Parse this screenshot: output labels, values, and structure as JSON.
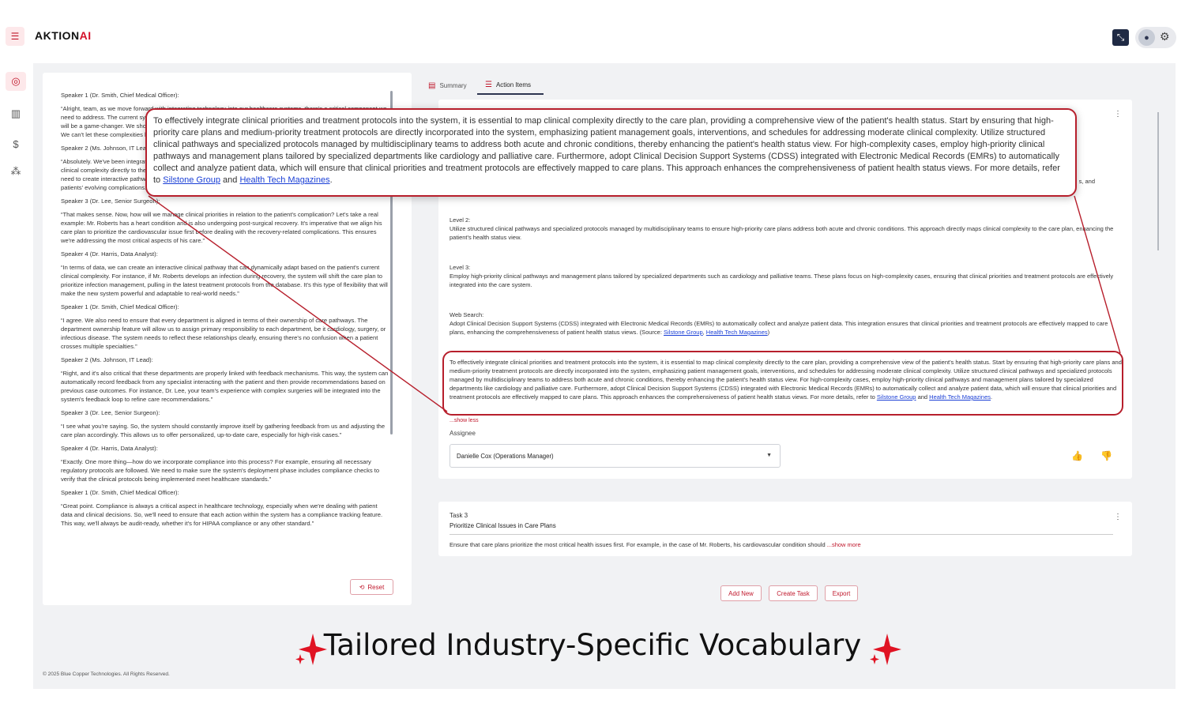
{
  "header": {
    "logo_main": "AKTION",
    "logo_accent": "AI",
    "menu_icon": "hamburger-icon",
    "collapse_icon": "collapse-icon",
    "avatar_icon": "user-icon",
    "settings_icon": "gear-icon"
  },
  "sidebar": {
    "icons": [
      "dashboard-icon",
      "bar-chart-icon",
      "dollar-icon",
      "team-icon"
    ]
  },
  "transcript": {
    "lines": [
      {
        "speaker": "Speaker 1 (Dr. Smith, Chief Medical Officer):",
        "text": "“Alright, team, as we move forward with integrating technology into our healthcare systems, there's a critical component we need to address. The current system isn't flexible enough. It's been too cumbersome. Moving toward interactive pathways will be a game-changer. We should also review the Clinical Complexity and how it connects to the patient's health status. We can't let these complexities hinder our goals.”"
      },
      {
        "speaker": "Speaker 2 (Ms. Johnson, IT Lead):",
        "text": "“Absolutely. We've been integrating the interactive clinical pathways. But we need to ensure there is a way to map the clinical complexity directly to the care plan, providing a comprehensive view of the patient's health status. I also think we need to create interactive pathways that update milestones in real-time. The dynamic flow will make it easier to adapt to patients' evolving complications.”"
      },
      {
        "speaker": "Speaker 3 (Dr. Lee, Senior Surgeon):",
        "text": "“That makes sense. Now, how will we manage clinical priorities in relation to the patient's complication? Let's take a real example: Mr. Roberts has a heart condition and is also undergoing post-surgical recovery. It's imperative that we align his care plan to prioritize the cardiovascular issue first before dealing with the recovery-related complications. This ensures we're addressing the most critical aspects of his care.”"
      },
      {
        "speaker": "Speaker 4 (Dr. Harris, Data Analyst):",
        "text": "“In terms of data, we can create an interactive clinical pathway that can dynamically adapt based on the patient's current clinical complexity. For instance, if Mr. Roberts develops an infection during recovery, the system will shift the care plan to prioritize infection management, pulling in the latest treatment protocols from the database. It's this type of flexibility that will make the new system powerful and adaptable to real-world needs.”"
      },
      {
        "speaker": "Speaker 1 (Dr. Smith, Chief Medical Officer):",
        "text": "“I agree. We also need to ensure that every department is aligned in terms of their ownership of care pathways. The department ownership feature will allow us to assign primary responsibility to each department, be it cardiology, surgery, or infectious disease. The system needs to reflect these relationships clearly, ensuring there's no confusion when a patient crosses multiple specialties.”"
      },
      {
        "speaker": "Speaker 2 (Ms. Johnson, IT Lead):",
        "text": "“Right, and it's also critical that these departments are properly linked with feedback mechanisms. This way, the system can automatically record feedback from any specialist interacting with the patient and then provide recommendations based on previous case outcomes. For instance, Dr. Lee, your team's experience with complex surgeries will be integrated into the system's feedback loop to refine care recommendations.”"
      },
      {
        "speaker": "Speaker 3 (Dr. Lee, Senior Surgeon):",
        "text": "“I see what you're saying. So, the system should constantly improve itself by gathering feedback from us and adjusting the care plan accordingly. This allows us to offer personalized, up-to-date care, especially for high-risk cases.”"
      },
      {
        "speaker": "Speaker 4 (Dr. Harris, Data Analyst):",
        "text": "“Exactly. One more thing—how do we incorporate compliance into this process? For example, ensuring all necessary regulatory protocols are followed. We need to make sure the system's deployment phase includes compliance checks to verify that the clinical protocols being implemented meet healthcare standards.”"
      },
      {
        "speaker": "Speaker 1 (Dr. Smith, Chief Medical Officer):",
        "text": "“Great point. Compliance is always a critical aspect in healthcare technology, especially when we're dealing with patient data and clinical decisions. So, we'll need to ensure that each action within the system has a compliance tracking feature. This way, we'll always be audit-ready, whether it's for HIPAA compliance or any other standard.”"
      }
    ],
    "reset_label": "Reset"
  },
  "tabs": [
    {
      "label": "Summary",
      "icon": "document-icon"
    },
    {
      "label": "Action Items",
      "icon": "checklist-icon"
    }
  ],
  "task2": {
    "level2_title": "Level 2:",
    "level2_text": "Utilize structured clinical pathways and specialized protocols managed by multidisciplinary teams to ensure high-priority care plans address both acute and chronic conditions. This approach directly maps clinical complexity to the care plan, enhancing the patient's health status view.",
    "level3_title": "Level 3:",
    "level3_text": "Employ high-priority clinical pathways and management plans tailored by specialized departments such as cardiology and palliative teams. These plans focus on high-complexity cases, ensuring that clinical priorities and treatment protocols are effectively integrated into the care system.",
    "web_title": "Web Search:",
    "web_text": "Adopt Clinical Decision Support Systems (CDSS) integrated with Electronic Medical Records (EMRs) to automatically collect and analyze patient data. This integration ensures that clinical priorities and treatment protocols are effectively mapped to care plans, enhancing the comprehensiveness of patient health status views. (Source: ",
    "web_link1": "Silstone Group",
    "web_link2": "Health Tech Magazines",
    "web_close": ")",
    "combined_text": "To effectively integrate clinical priorities and treatment protocols into the system, it is essential to map clinical complexity directly to the care plan, providing a comprehensive view of the patient's health status. Start by ensuring that high-priority care plans and medium-priority treatment protocols are directly incorporated into the system, emphasizing patient management goals, interventions, and schedules for addressing moderate clinical complexity. Utilize structured clinical pathways and specialized protocols managed by multidisciplinary teams to address both acute and chronic conditions, thereby enhancing the patient's health status view. For high-complexity cases, employ high-priority clinical pathways and management plans tailored by specialized departments like cardiology and palliative care. Furthermore, adopt Clinical Decision Support Systems (CDSS) integrated with Electronic Medical Records (EMRs) to automatically collect and analyze patient data, which will ensure that clinical priorities and treatment protocols are effectively mapped to care plans. This approach enhances the comprehensiveness of patient health status views. For more details, refer to ",
    "link1": "Silstone Group",
    "link_and": " and ",
    "link2": "Health Tech Magazines",
    "link_end": ".",
    "show_less": "...show less",
    "assignee_label": "Assignee",
    "assignee_value": "Danielle Cox (Operations Manager)",
    "hidden_tail": "s, and"
  },
  "task3": {
    "title": "Task 3",
    "subtitle": "Prioritize Clinical Issues in Care Plans",
    "desc": "Ensure that care plans prioritize the most critical health issues first. For example, in the case of Mr. Roberts, his cardiovascular condition should ",
    "show_more": "...show more"
  },
  "actions": {
    "add_new": "Add New",
    "create_task": "Create Task",
    "export": "Export"
  },
  "tagline": "Tailored Industry-Specific Vocabulary",
  "footer": "© 2025 Blue Copper Technologies. All Rights Reserved.",
  "colors": {
    "accent": "#c0182c",
    "outline": "#b71f2c",
    "navy": "#1f2a44",
    "link": "#1a3fd6"
  }
}
